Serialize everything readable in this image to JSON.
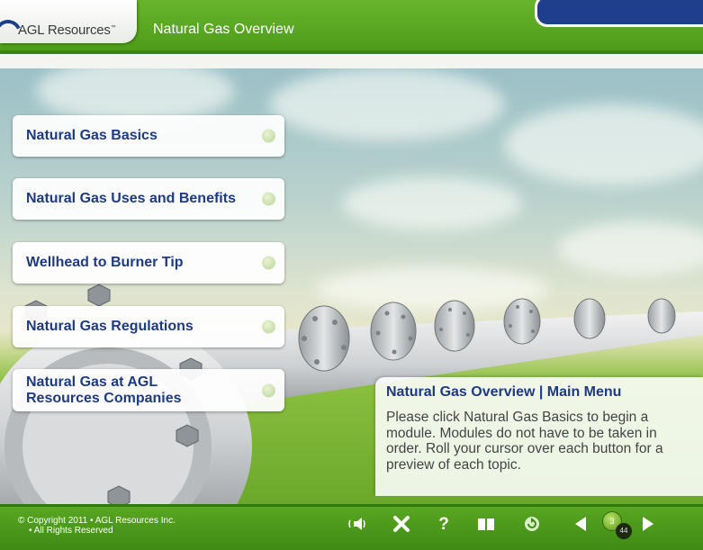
{
  "header": {
    "logo_text": "AGL Resources",
    "logo_tm": "™",
    "title": "Natural Gas Overview"
  },
  "menu": [
    {
      "label": "Natural Gas Basics"
    },
    {
      "label": "Natural Gas Uses and Benefits"
    },
    {
      "label": "Wellhead to Burner Tip"
    },
    {
      "label": "Natural Gas Regulations"
    },
    {
      "label": "Natural Gas at AGL Resources Companies"
    }
  ],
  "info": {
    "title": "Natural Gas Overview | Main Menu",
    "body": "Please click Natural Gas Basics to begin a module. Modules do not have to be taken in order. Roll your cursor over each button for a preview of each topic."
  },
  "footer": {
    "copyright_line1": "© Copyright 2011 • AGL Resources Inc.",
    "copyright_line2": "• All Rights Reserved",
    "page_current": "3",
    "page_total": "44"
  },
  "colors": {
    "brand_green": "#5aa823",
    "brand_blue": "#1d3a82",
    "header_panel_blue": "#1f3e8c"
  },
  "icons": [
    "audio-icon",
    "exit-icon",
    "help-icon",
    "book-icon",
    "refresh-icon",
    "previous-icon",
    "next-icon"
  ]
}
